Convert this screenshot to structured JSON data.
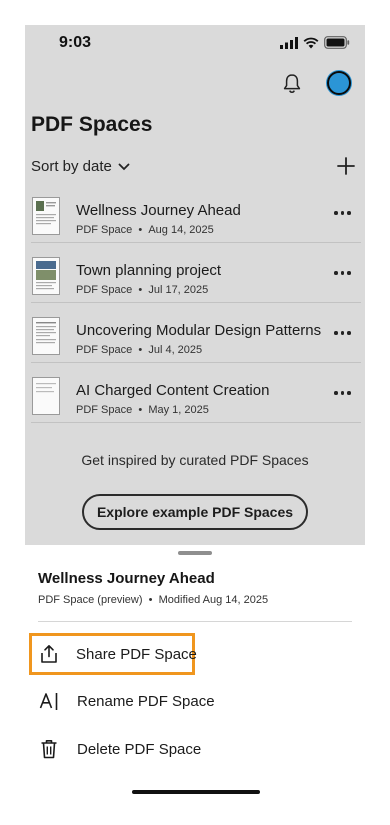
{
  "status_bar": {
    "time": "9:03"
  },
  "header": {
    "title": "PDF Spaces",
    "sort_label": "Sort by date"
  },
  "items": [
    {
      "title": "Wellness Journey Ahead",
      "type": "PDF Space",
      "date": "Aug 14, 2025"
    },
    {
      "title": "Town planning project",
      "type": "PDF Space",
      "date": "Jul 17, 2025"
    },
    {
      "title": "Uncovering Modular Design Patterns",
      "type": "PDF Space",
      "date": "Jul 4, 2025"
    },
    {
      "title": "AI Charged Content Creation",
      "type": "PDF Space",
      "date": "May 1, 2025"
    }
  ],
  "inspire_text": "Get inspired by curated PDF Spaces",
  "explore_label": "Explore example PDF Spaces",
  "sheet": {
    "title": "Wellness Journey Ahead",
    "type": "PDF Space (preview)",
    "modified": "Modified Aug 14, 2025",
    "actions": {
      "share": "Share PDF Space",
      "rename": "Rename PDF Space",
      "delete": "Delete PDF Space"
    },
    "highlight_color": "#f0961e"
  },
  "colors": {
    "avatar": "#2b95d6",
    "dim_overlay": "#dadada"
  }
}
